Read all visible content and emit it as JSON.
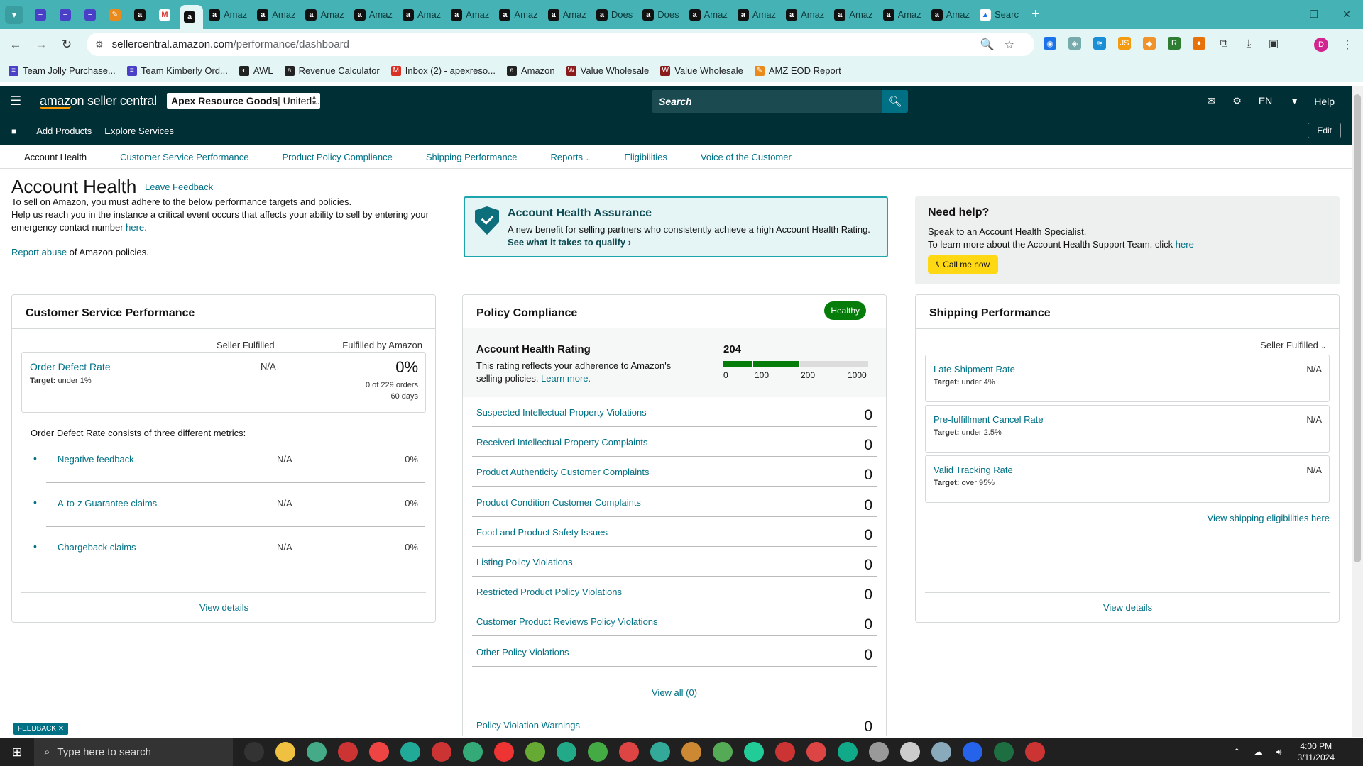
{
  "browser": {
    "tabs": [
      {
        "icon": "sheets-icon",
        "label": ""
      },
      {
        "icon": "sheets-icon",
        "label": ""
      },
      {
        "icon": "sheets-icon",
        "label": ""
      },
      {
        "icon": "app-icon",
        "label": ""
      },
      {
        "icon": "amazon-icon",
        "label": ""
      },
      {
        "icon": "gmail-icon",
        "label": ""
      },
      {
        "icon": "amazon-icon",
        "label": "",
        "active": true
      },
      {
        "icon": "amazon-icon",
        "label": "Amaz"
      },
      {
        "icon": "amazon-icon",
        "label": "Amaz"
      },
      {
        "icon": "amazon-icon",
        "label": "Amaz"
      },
      {
        "icon": "amazon-icon",
        "label": "Amaz"
      },
      {
        "icon": "amazon-icon",
        "label": "Amaz"
      },
      {
        "icon": "amazon-icon",
        "label": "Amaz"
      },
      {
        "icon": "amazon-icon",
        "label": "Amaz"
      },
      {
        "icon": "amazon-icon",
        "label": "Amaz"
      },
      {
        "icon": "amazon-icon",
        "label": "Does"
      },
      {
        "icon": "amazon-icon",
        "label": "Does"
      },
      {
        "icon": "amazon-icon",
        "label": "Amaz"
      },
      {
        "icon": "amazon-icon",
        "label": "Amaz"
      },
      {
        "icon": "amazon-icon",
        "label": "Amaz"
      },
      {
        "icon": "amazon-icon",
        "label": "Amaz"
      },
      {
        "icon": "amazon-icon",
        "label": "Amaz"
      },
      {
        "icon": "amazon-icon",
        "label": "Amaz"
      },
      {
        "icon": "google-drive-icon",
        "label": "Searc"
      }
    ],
    "url_host": "sellercentral.amazon.com",
    "url_path": "/performance/dashboard",
    "bookmarks": [
      {
        "icon": "sheets-icon",
        "label": "Team Jolly Purchase..."
      },
      {
        "icon": "sheets-icon",
        "label": "Team Kimberly Ord..."
      },
      {
        "icon": "awl-icon",
        "label": "AWL"
      },
      {
        "icon": "amazon-icon",
        "label": "Revenue Calculator"
      },
      {
        "icon": "gmail-icon",
        "label": "Inbox (2) - apexreso..."
      },
      {
        "icon": "amazon-icon",
        "label": "Amazon"
      },
      {
        "icon": "vw-icon",
        "label": "Value Wholesale"
      },
      {
        "icon": "vw-icon",
        "label": "Value Wholesale"
      },
      {
        "icon": "app-icon",
        "label": "AMZ EOD Report"
      }
    ],
    "profile_initial": "D"
  },
  "header": {
    "logo": "amazon seller central",
    "account_bold": "Apex Resource Goods",
    "account_rest": " | United...",
    "search_placeholder": "Search",
    "lang": "EN",
    "help": "Help",
    "links": [
      "Add Products",
      "Explore Services"
    ],
    "edit": "Edit"
  },
  "subnav": [
    "Account Health",
    "Customer Service Performance",
    "Product Policy Compliance",
    "Shipping Performance",
    "Reports",
    "Eligibilities",
    "Voice of the Customer"
  ],
  "page": {
    "title": "Account Health",
    "leave_feedback": "Leave Feedback",
    "intro1": "To sell on Amazon, you must adhere to the below performance targets and policies.",
    "intro2": "Help us reach you in the instance a critical event occurs that affects your ability to sell by entering your emergency contact number ",
    "intro_here": "here.",
    "report_link": "Report abuse",
    "report_rest": " of Amazon policies."
  },
  "assurance": {
    "title": "Account Health Assurance",
    "text": "A new benefit for selling partners who consistently achieve a high Account Health Rating.",
    "cta": "See what it takes to qualify"
  },
  "help_box": {
    "title": "Need help?",
    "line1": "Speak to an Account Health Specialist.",
    "line2": "To learn more about the Account Health Support Team, click ",
    "line2_link": "here",
    "button": "Call me now"
  },
  "customer_service": {
    "title": "Customer Service Performance",
    "col_seller": "Seller Fulfilled",
    "col_fba": "Fulfilled by Amazon",
    "odr_name": "Order Defect Rate",
    "odr_target_label": "Target:",
    "odr_target": "under 1%",
    "odr_seller": "N/A",
    "odr_fba": "0%",
    "odr_orders": "0 of 229 orders",
    "odr_days": "60 days",
    "consists": "Order Defect Rate consists of three different metrics:",
    "metrics": [
      {
        "name": "Negative feedback",
        "seller": "N/A",
        "fba": "0%"
      },
      {
        "name": "A-to-z Guarantee claims",
        "seller": "N/A",
        "fba": "0%"
      },
      {
        "name": "Chargeback claims",
        "seller": "N/A",
        "fba": "0%"
      }
    ],
    "view_details": "View details"
  },
  "policy": {
    "title": "Policy Compliance",
    "status": "Healthy",
    "rating_title": "Account Health Rating",
    "rating_desc": "This rating reflects your adherence to Amazon's selling policies. ",
    "learn_more": "Learn more.",
    "score": "204",
    "scale_labels": [
      "0",
      "100",
      "200",
      "1000"
    ],
    "rating_value": 204,
    "rows": [
      {
        "name": "Suspected Intellectual Property Violations",
        "value": "0"
      },
      {
        "name": "Received Intellectual Property Complaints",
        "value": "0"
      },
      {
        "name": "Product Authenticity Customer Complaints",
        "value": "0"
      },
      {
        "name": "Product Condition Customer Complaints",
        "value": "0"
      },
      {
        "name": "Food and Product Safety Issues",
        "value": "0"
      },
      {
        "name": "Listing Policy Violations",
        "value": "0"
      },
      {
        "name": "Restricted Product Policy Violations",
        "value": "0"
      },
      {
        "name": "Customer Product Reviews Policy Violations",
        "value": "0"
      },
      {
        "name": "Other Policy Violations",
        "value": "0"
      }
    ],
    "view_all": "View all (0)",
    "warnings": "Policy Violation Warnings",
    "warnings_value": "0"
  },
  "shipping": {
    "title": "Shipping Performance",
    "filter": "Seller Fulfilled",
    "rows": [
      {
        "name": "Late Shipment Rate",
        "target": "under 4%",
        "value": "N/A"
      },
      {
        "name": "Pre-fulfillment Cancel Rate",
        "target": "under 2.5%",
        "value": "N/A"
      },
      {
        "name": "Valid Tracking Rate",
        "target": "over 95%",
        "value": "N/A"
      }
    ],
    "eligibilities": "View shipping eligibilities here",
    "view_details": "View details"
  },
  "feedback_tab": "FEEDBACK",
  "taskbar": {
    "search": "Type here to search",
    "time": "4:00 PM",
    "date": "3/11/2024"
  },
  "colors": {
    "accent": "#007185",
    "header": "#002f36",
    "healthy": "#067d0a",
    "button": "#ffd814"
  }
}
